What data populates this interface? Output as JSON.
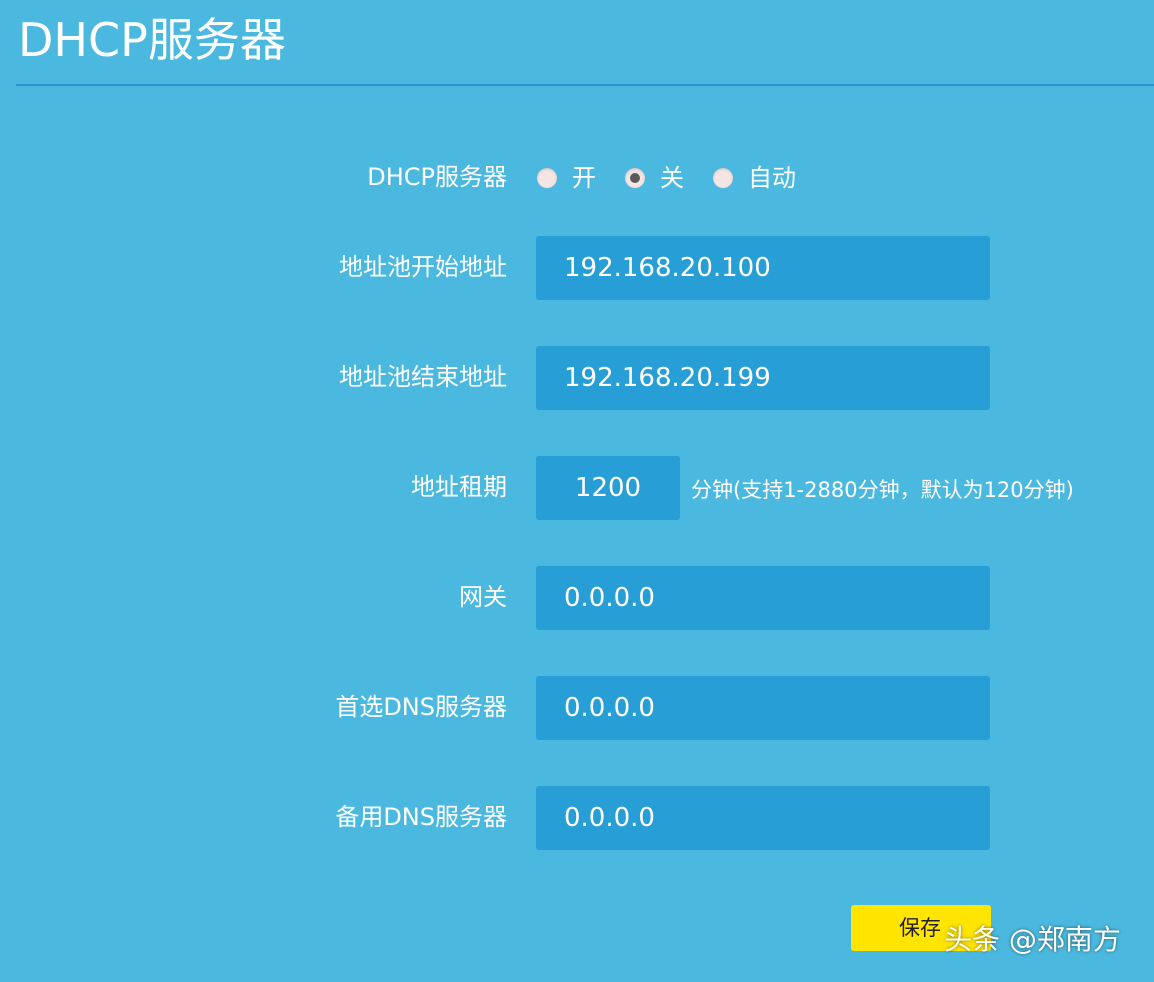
{
  "page": {
    "title": "DHCP服务器"
  },
  "form": {
    "dhcp_server": {
      "label": "DHCP服务器",
      "options": [
        {
          "label": "开",
          "checked": false
        },
        {
          "label": "关",
          "checked": true
        },
        {
          "label": "自动",
          "checked": false
        }
      ]
    },
    "pool_start": {
      "label": "地址池开始地址",
      "value": "192.168.20.100"
    },
    "pool_end": {
      "label": "地址池结束地址",
      "value": "192.168.20.199"
    },
    "lease_time": {
      "label": "地址租期",
      "value": "1200",
      "hint": "分钟(支持1-2880分钟，默认为120分钟)"
    },
    "gateway": {
      "label": "网关",
      "value": "0.0.0.0"
    },
    "primary_dns": {
      "label": "首选DNS服务器",
      "value": "0.0.0.0"
    },
    "secondary_dns": {
      "label": "备用DNS服务器",
      "value": "0.0.0.0"
    }
  },
  "actions": {
    "save_label": "保存"
  },
  "watermark": {
    "text": "头条 @郑南方"
  },
  "colors": {
    "background": "#4bb9df",
    "field_background": "#279fd6",
    "divider": "#2a93cc",
    "save_button": "#ffe500"
  }
}
